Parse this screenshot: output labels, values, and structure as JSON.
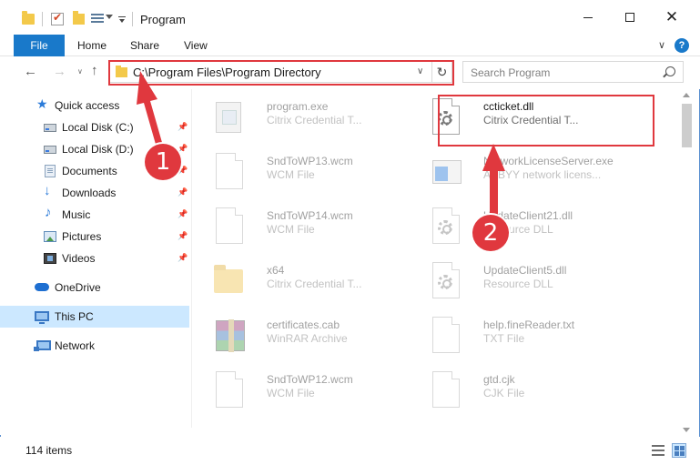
{
  "window": {
    "title": "Program",
    "minimize_icon": "minimize-icon",
    "maximize_icon": "maximize-icon",
    "close_glyph": "✕"
  },
  "ribbon": {
    "tabs": [
      "File",
      "Home",
      "Share",
      "View"
    ],
    "collapse_glyph": "∨",
    "help_glyph": "?"
  },
  "nav": {
    "back_glyph": "←",
    "forward_glyph": "→",
    "recent_glyph": "∨",
    "up_glyph": "↑"
  },
  "address": {
    "path": "C:\\Program Files\\Program Directory",
    "dropdown_glyph": "∨",
    "refresh_glyph": "↻"
  },
  "search": {
    "placeholder": "Search Program"
  },
  "sidebar": {
    "items": [
      {
        "label": "Quick access",
        "icon": "star-icon",
        "pinned": false
      },
      {
        "label": "Local Disk (C:)",
        "icon": "drive-icon",
        "pinned": true
      },
      {
        "label": "Local Disk (D:)",
        "icon": "drive-icon",
        "pinned": true
      },
      {
        "label": "Documents",
        "icon": "documents-icon",
        "pinned": true
      },
      {
        "label": "Downloads",
        "icon": "download-icon",
        "pinned": true
      },
      {
        "label": "Music",
        "icon": "music-icon",
        "pinned": true
      },
      {
        "label": "Pictures",
        "icon": "pictures-icon",
        "pinned": true
      },
      {
        "label": "Videos",
        "icon": "videos-icon",
        "pinned": true
      },
      {
        "label": "OneDrive",
        "icon": "onedrive-icon",
        "pinned": false
      },
      {
        "label": "This PC",
        "icon": "this-pc-icon",
        "pinned": false,
        "selected": true
      },
      {
        "label": "Network",
        "icon": "network-icon",
        "pinned": false
      }
    ]
  },
  "files": [
    {
      "name": "program.exe",
      "type": "Citrix Credential T...",
      "icon": "program-icon",
      "highlighted": false
    },
    {
      "name": "ccticket.dll",
      "type": "Citrix Credential T...",
      "icon": "dll-gear-icon",
      "highlighted": true
    },
    {
      "name": "SndToWP13.wcm",
      "type": "WCM File",
      "icon": "blank-file-icon",
      "highlighted": false
    },
    {
      "name": "NetworkLicenseServer.exe",
      "type": "ABBYY network licens...",
      "icon": "exe-icon",
      "highlighted": false
    },
    {
      "name": "SndToWP14.wcm",
      "type": "WCM File",
      "icon": "blank-file-icon",
      "highlighted": false
    },
    {
      "name": "UpdateClient21.dll",
      "type": "Resource DLL",
      "icon": "dll-gear-icon",
      "highlighted": false
    },
    {
      "name": "x64",
      "type": "Citrix Credential T...",
      "icon": "folder-icon",
      "highlighted": false
    },
    {
      "name": "UpdateClient5.dll",
      "type": "Resource DLL",
      "icon": "dll-gear-icon",
      "highlighted": false
    },
    {
      "name": "certificates.cab",
      "type": "WinRAR Archive",
      "icon": "archive-icon",
      "highlighted": false
    },
    {
      "name": "help.fineReader.txt",
      "type": "TXT File",
      "icon": "blank-file-icon",
      "highlighted": false
    },
    {
      "name": "SndToWP12.wcm",
      "type": "WCM File",
      "icon": "blank-file-icon",
      "highlighted": false
    },
    {
      "name": "gtd.cjk",
      "type": "CJK File",
      "icon": "blank-file-icon",
      "highlighted": false
    }
  ],
  "status": {
    "item_count": "114 items"
  },
  "callouts": [
    "1",
    "2"
  ],
  "colors": {
    "accent": "#1979ca",
    "annotation_red": "#e0383e",
    "selection": "#cce8ff"
  }
}
